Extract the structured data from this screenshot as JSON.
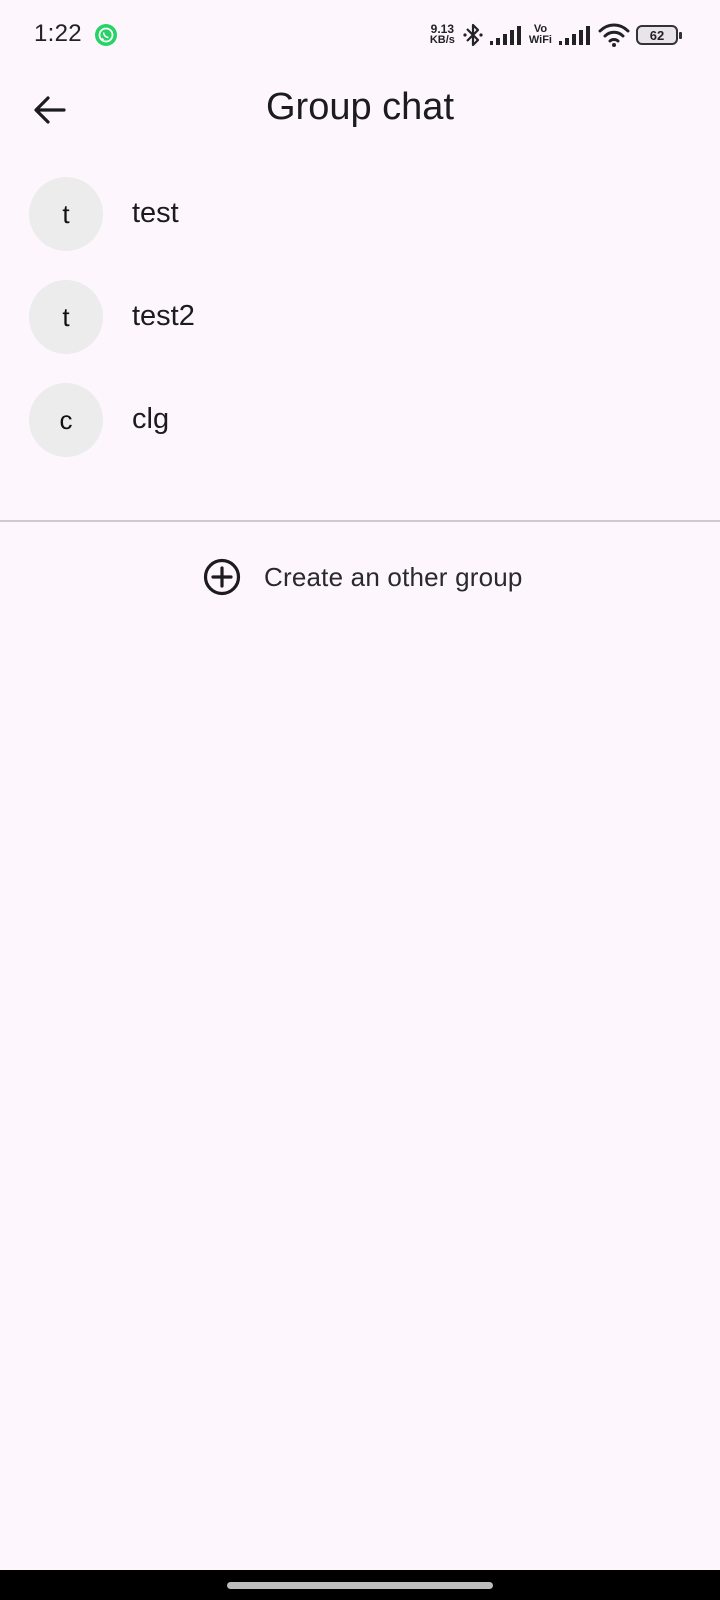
{
  "status_bar": {
    "time": "1:22",
    "notification_icon": "whatsapp-icon",
    "net_speed_value": "9.13",
    "net_speed_unit": "KB/s",
    "vowifi_top": "Vo",
    "vowifi_bottom": "WiFi",
    "battery_level": "62",
    "icons": [
      "bluetooth-icon",
      "signal-icon",
      "wifi-icon",
      "battery-icon"
    ]
  },
  "app_bar": {
    "title": "Group chat",
    "back_icon": "arrow-back-icon"
  },
  "groups": [
    {
      "initial": "t",
      "name": "test"
    },
    {
      "initial": "t",
      "name": "test2"
    },
    {
      "initial": "c",
      "name": "clg"
    }
  ],
  "actions": {
    "create_group_label": "Create an other group",
    "create_group_icon": "add-circle-icon"
  },
  "colors": {
    "background": "#fdf6fd",
    "avatar_bg": "#ececec",
    "divider": "#cfc8d0",
    "whatsapp_green": "#25d366"
  }
}
